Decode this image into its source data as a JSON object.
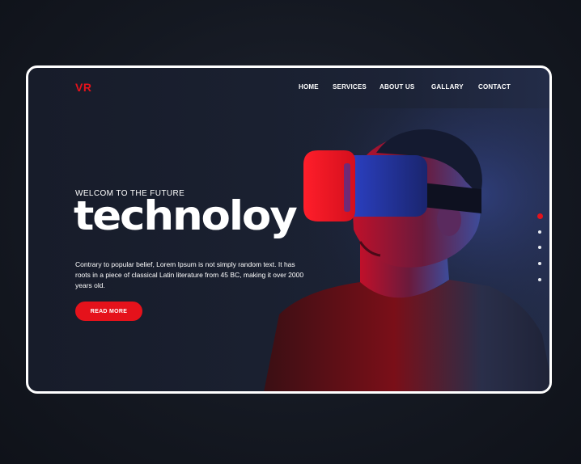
{
  "brand": {
    "logo": "VR",
    "accent": "#e5121b"
  },
  "nav": {
    "items": [
      {
        "label": "HOME"
      },
      {
        "label": "SERVICES"
      },
      {
        "label": "ABOUT US"
      },
      {
        "label": "GALLARY"
      },
      {
        "label": "CONTACT"
      }
    ]
  },
  "hero": {
    "eyebrow": "WELCOM TO THE FUTURE",
    "headline": "technoloy",
    "description": "Contrary to popular belief, Lorem Ipsum is not simply random text. It has roots in a piece of classical Latin literature from 45 BC, making it over 2000 years old.",
    "cta_label": "READ MORE",
    "image_icon": "vr-headset-person-image"
  },
  "pagination": {
    "count": 5,
    "active": 1
  }
}
